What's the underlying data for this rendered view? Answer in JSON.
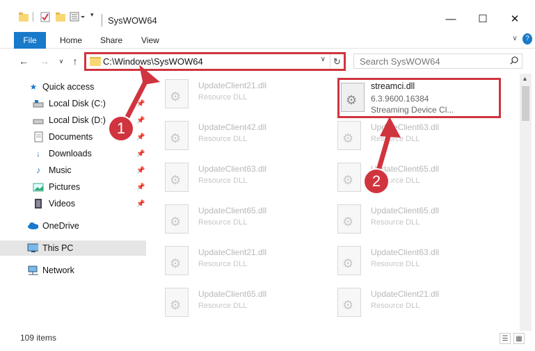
{
  "window": {
    "title": "SysWOW64",
    "controls": {
      "minimize": "—",
      "maximize": "☐",
      "close": "✕"
    }
  },
  "ribbon": {
    "tabs": [
      "File",
      "Home",
      "Share",
      "View"
    ]
  },
  "navbar": {
    "back": "←",
    "forward": "→",
    "recent": "∨",
    "up": "↑",
    "address": "C:\\Windows\\SysWOW64",
    "search_placeholder": "Search SysWOW64"
  },
  "sidebar": {
    "items": [
      {
        "label": "Quick access",
        "icon": "star-icon",
        "pinned": false
      },
      {
        "label": "Local Disk (C:)",
        "icon": "drive-icon",
        "pinned": true
      },
      {
        "label": "Local Disk (D:)",
        "icon": "drive-icon",
        "pinned": true
      },
      {
        "label": "Documents",
        "icon": "documents-icon",
        "pinned": true
      },
      {
        "label": "Downloads",
        "icon": "download-icon",
        "pinned": true
      },
      {
        "label": "Music",
        "icon": "music-icon",
        "pinned": true
      },
      {
        "label": "Pictures",
        "icon": "pictures-icon",
        "pinned": true
      },
      {
        "label": "Videos",
        "icon": "videos-icon",
        "pinned": true
      },
      {
        "label": "OneDrive",
        "icon": "cloud-icon",
        "pinned": false
      },
      {
        "label": "This PC",
        "icon": "computer-icon",
        "pinned": false,
        "selected": true
      },
      {
        "label": "Network",
        "icon": "network-icon",
        "pinned": false
      }
    ]
  },
  "files": {
    "column1": [
      {
        "name": "UpdateClient21.dll",
        "type": "Resource DLL"
      },
      {
        "name": "UpdateClient42.dll",
        "type": "Resource DLL"
      },
      {
        "name": "UpdateClient63.dll",
        "type": "Resource DLL"
      },
      {
        "name": "UpdateClient65.dll",
        "type": "Resource DLL"
      },
      {
        "name": "UpdateClient21.dll",
        "type": "Resource DLL"
      },
      {
        "name": "UpdateClient65.dll",
        "type": "Resource DLL"
      }
    ],
    "column2": [
      {
        "name": "UpdateClient63.dll",
        "type": "Resource DLL"
      },
      {
        "name": "UpdateClient65.dll",
        "type": "Resource DLL"
      },
      {
        "name": "UpdateClient65.dll",
        "type": "Resource DLL"
      },
      {
        "name": "UpdateClient63.dll",
        "type": "Resource DLL"
      },
      {
        "name": "UpdateClient21.dll",
        "type": "Resource DLL"
      }
    ],
    "target": {
      "name": "streamci.dll",
      "version": "6.3.9600.16384",
      "description": "Streaming Device Cl..."
    }
  },
  "status": {
    "item_count": "109 items"
  },
  "annotations": {
    "badge1": "1",
    "badge2": "2",
    "color": "#d0343f"
  }
}
